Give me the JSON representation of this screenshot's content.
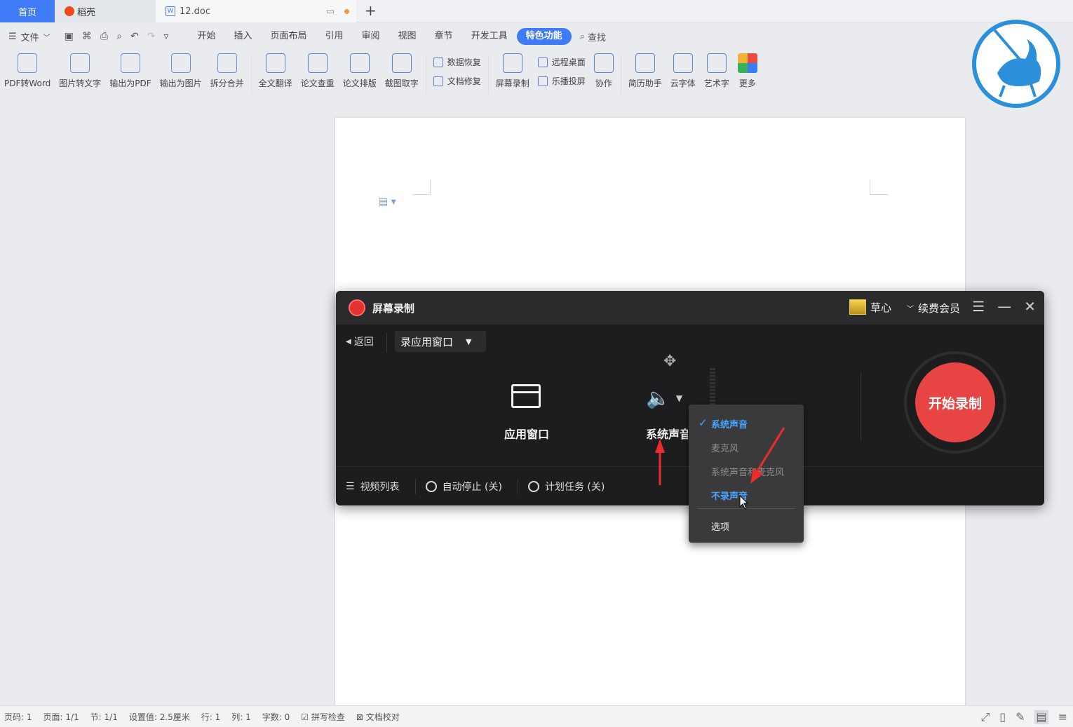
{
  "tabs": {
    "home": "首页",
    "daoke": "稻壳",
    "doc": "12.doc"
  },
  "menu": {
    "file": "文件",
    "tabs": [
      "开始",
      "插入",
      "页面布局",
      "引用",
      "审阅",
      "视图",
      "章节",
      "开发工具",
      "特色功能"
    ],
    "active_tab": "特色功能",
    "search": "查找"
  },
  "ribbon": {
    "group1": [
      "PDF转Word",
      "图片转文字",
      "输出为PDF",
      "输出为图片",
      "拆分合并"
    ],
    "group2": [
      "全文翻译",
      "论文查重",
      "论文排版",
      "截图取字"
    ],
    "group3_small": [
      "数据恢复",
      "文档修复"
    ],
    "group4": [
      "屏幕录制"
    ],
    "group4_small": [
      "远程桌面",
      "乐播投屏"
    ],
    "group4b": [
      "协作"
    ],
    "group5": [
      "简历助手",
      "云字体",
      "艺术字",
      "更多"
    ]
  },
  "statusbar": {
    "page_num": "页码: 1",
    "pages": "页面: 1/1",
    "section": "节: 1/1",
    "setting": "设置值: 2.5厘米",
    "row": "行: 1",
    "col": "列: 1",
    "words": "字数: 0",
    "spell": "拼写检查",
    "proof": "文档校对"
  },
  "recorder": {
    "title": "屏幕录制",
    "user": "草心",
    "renew": "续费会员",
    "back": "返回",
    "mode": "录应用窗口",
    "window_label": "应用窗口",
    "audio_label": "系统声音",
    "start": "开始录制",
    "footer": {
      "video_list": "视频列表",
      "auto_stop": "自动停止 (关)",
      "schedule": "计划任务 (关)"
    }
  },
  "dropdown": {
    "items": [
      "系统声音",
      "麦克风",
      "系统声音和麦克风",
      "不录声音"
    ],
    "selected": "系统声音",
    "hovered": "不录声音",
    "options": "选项"
  },
  "colors": {
    "accent": "#3f7bf6",
    "record_red": "#e84444",
    "menu_highlight": "#4aa3ff",
    "recorder_bg": "#1d1d1f",
    "annotation_arrow": "#ee2b2b"
  }
}
